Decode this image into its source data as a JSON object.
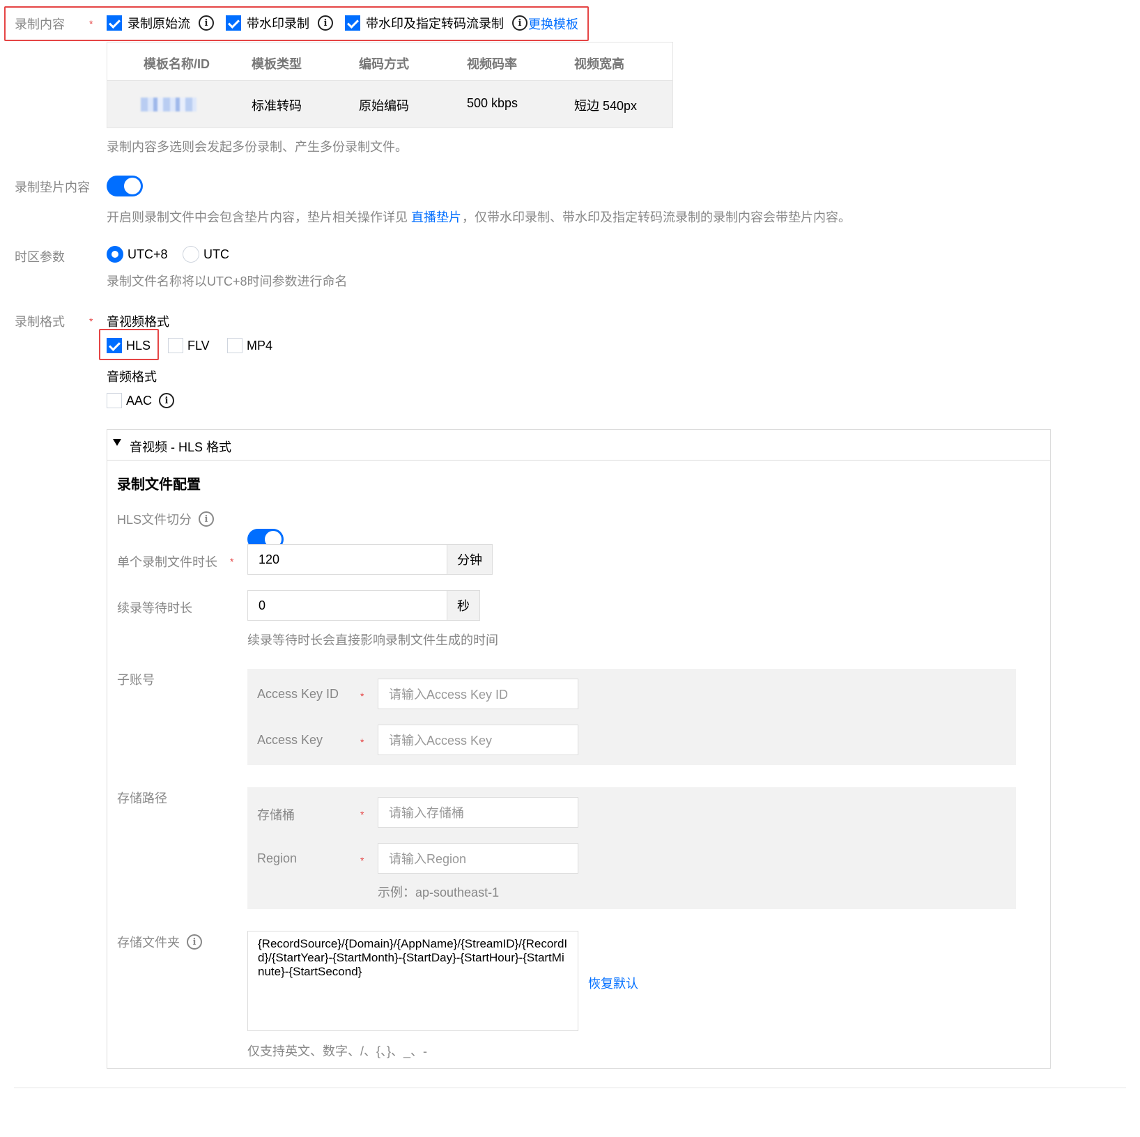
{
  "record_content": {
    "label": "录制内容",
    "options": [
      {
        "label": "录制原始流",
        "checked": true
      },
      {
        "label": "带水印录制",
        "checked": true
      },
      {
        "label": "带水印及指定转码流录制",
        "checked": true
      }
    ],
    "change_template_link": "更换模板",
    "table": {
      "headers": [
        "模板名称/ID",
        "模板类型",
        "编码方式",
        "视频码率",
        "视频宽高"
      ],
      "row": [
        "",
        "标准转码",
        "原始编码",
        "500 kbps",
        "短边 540px"
      ]
    },
    "hint": "录制内容多选则会发起多份录制、产生多份录制文件。"
  },
  "slate": {
    "label": "录制垫片内容",
    "enabled": true,
    "hint_before": "开启则录制文件中会包含垫片内容，垫片相关操作详见",
    "hint_link": "直播垫片",
    "hint_after": "，仅带水印录制、带水印及指定转码流录制的录制内容会带垫片内容。"
  },
  "timezone": {
    "label": "时区参数",
    "options": [
      "UTC+8",
      "UTC"
    ],
    "selected": "UTC+8",
    "hint": "录制文件名称将以UTC+8时间参数进行命名"
  },
  "format": {
    "label": "录制格式",
    "av_title": "音视频格式",
    "av_options": [
      {
        "label": "HLS",
        "checked": true
      },
      {
        "label": "FLV",
        "checked": false
      },
      {
        "label": "MP4",
        "checked": false
      }
    ],
    "audio_title": "音频格式",
    "audio_options": [
      {
        "label": "AAC",
        "checked": false
      }
    ]
  },
  "hls_panel": {
    "title": "音视频 - HLS 格式",
    "section_title": "录制文件配置",
    "split_label": "HLS文件切分",
    "split_enabled": true,
    "duration_label": "单个录制文件时长",
    "duration_value": "120",
    "duration_unit": "分钟",
    "wait_label": "续录等待时长",
    "wait_value": "0",
    "wait_unit": "秒",
    "wait_hint": "续录等待时长会直接影响录制文件生成的时间",
    "subaccount_label": "子账号",
    "access_key_id_label": "Access Key ID",
    "access_key_id_placeholder": "请输入Access Key ID",
    "access_key_label": "Access Key",
    "access_key_placeholder": "请输入Access Key",
    "storage_path_label": "存储路径",
    "bucket_label": "存储桶",
    "bucket_placeholder": "请输入存储桶",
    "region_label": "Region",
    "region_placeholder": "请输入Region",
    "region_example": "示例：ap-southeast-1",
    "folder_label": "存储文件夹",
    "folder_value": "{RecordSource}/{Domain}/{AppName}/{StreamID}/{RecordId}/{StartYear}-{StartMonth}-{StartDay}-{StartHour}-{StartMinute}-{StartSecond}",
    "restore_default": "恢复默认",
    "folder_hint": "仅支持英文、数字、/、{、}、_、-"
  },
  "colors": {
    "accent": "#006eff",
    "required": "#e54545",
    "highlight_box": "#e54545"
  }
}
